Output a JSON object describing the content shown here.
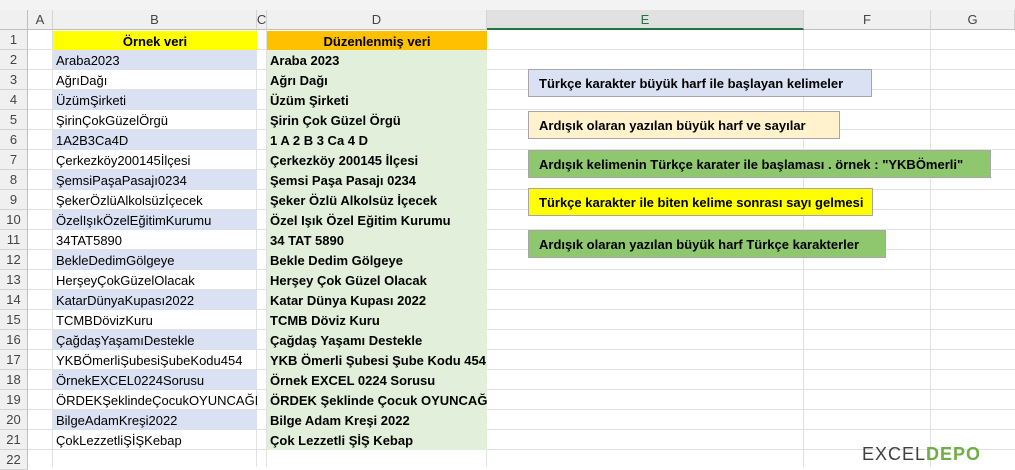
{
  "columns": [
    "A",
    "B",
    "C",
    "D",
    "E",
    "F",
    "G"
  ],
  "rows": [
    "1",
    "2",
    "3",
    "4",
    "5",
    "6",
    "7",
    "8",
    "9",
    "10",
    "11",
    "12",
    "13",
    "14",
    "15",
    "16",
    "17",
    "18",
    "19",
    "20",
    "21",
    "22"
  ],
  "header_b": "Örnek veri",
  "header_d": "Düzenlenmiş veri",
  "original": [
    "Araba2023",
    "AğrıDağı",
    "ÜzümŞirketi",
    "ŞirinÇokGüzelÖrgü",
    "1A2B3Ca4D",
    "Çerkezköy200145İlçesi",
    "ŞemsiPaşaPasajı0234",
    "ŞekerÖzlüAlkolsüzİçecek",
    "ÖzelIşıkÖzelEğitimKurumu",
    "34TAT5890",
    "BekleDedimGölgeye",
    "HerşeyÇokGüzelOlacak",
    "KatarDünyaKupası2022",
    "TCMBDövizKuru",
    "ÇağdaşYaşamıDestekle",
    "YKBÖmerliŞubesiŞubeKodu454",
    "ÖrnekEXCEL0224Sorusu",
    "ÖRDEKŞeklindeÇocukOYUNCAĞI",
    "BilgeAdamKreşi2022",
    "ÇokLezzetliŞİŞKebap"
  ],
  "edited": [
    "Araba 2023",
    "Ağrı Dağı",
    "Üzüm Şirketi",
    "Şirin Çok Güzel Örgü",
    "1 A 2 B 3 Ca 4 D",
    "Çerkezköy 200145 İlçesi",
    "Şemsi Paşa Pasajı 0234",
    "Şeker Özlü Alkolsüz İçecek",
    "Özel Işık Özel Eğitim Kurumu",
    "34 TAT 5890",
    "Bekle Dedim Gölgeye",
    "Herşey Çok Güzel Olacak",
    "Katar Dünya Kupası 2022",
    "TCMB Döviz Kuru",
    "Çağdaş Yaşamı Destekle",
    "YKB Ömerli Şubesi Şube Kodu 454",
    "Örnek EXCEL 0224 Sorusu",
    "ÖRDEK Şeklinde Çocuk OYUNCAĞI",
    "Bilge Adam Kreşi 2022",
    "Çok Lezzetli ŞİŞ Kebap"
  ],
  "legend": {
    "blue": "Türkçe karakter büyük harf ile başlayan kelimeler",
    "cream": "Ardışık olaran yazılan büyük harf ve sayılar",
    "green": "Ardışık kelimenin Türkçe karater ile başlaması . örnek :  \"YKBÖmerli\"",
    "yellow": "Türkçe karakter ile biten kelime sonrası sayı gelmesi",
    "green2": "Ardışık olaran yazılan büyük harf  Türkçe karakterler"
  },
  "colors": {
    "header_b": "#ffff00",
    "header_d": "#ffc000",
    "blue_fill": "#d9e1f2",
    "green_fill": "#e2efda",
    "note_blue": "#d9e1f2",
    "note_cream": "#fff2cc",
    "note_green": "#8fc76e",
    "note_yellow": "#ffff00"
  },
  "logo": {
    "text": "EXCEL",
    "accent": "DEPO"
  }
}
